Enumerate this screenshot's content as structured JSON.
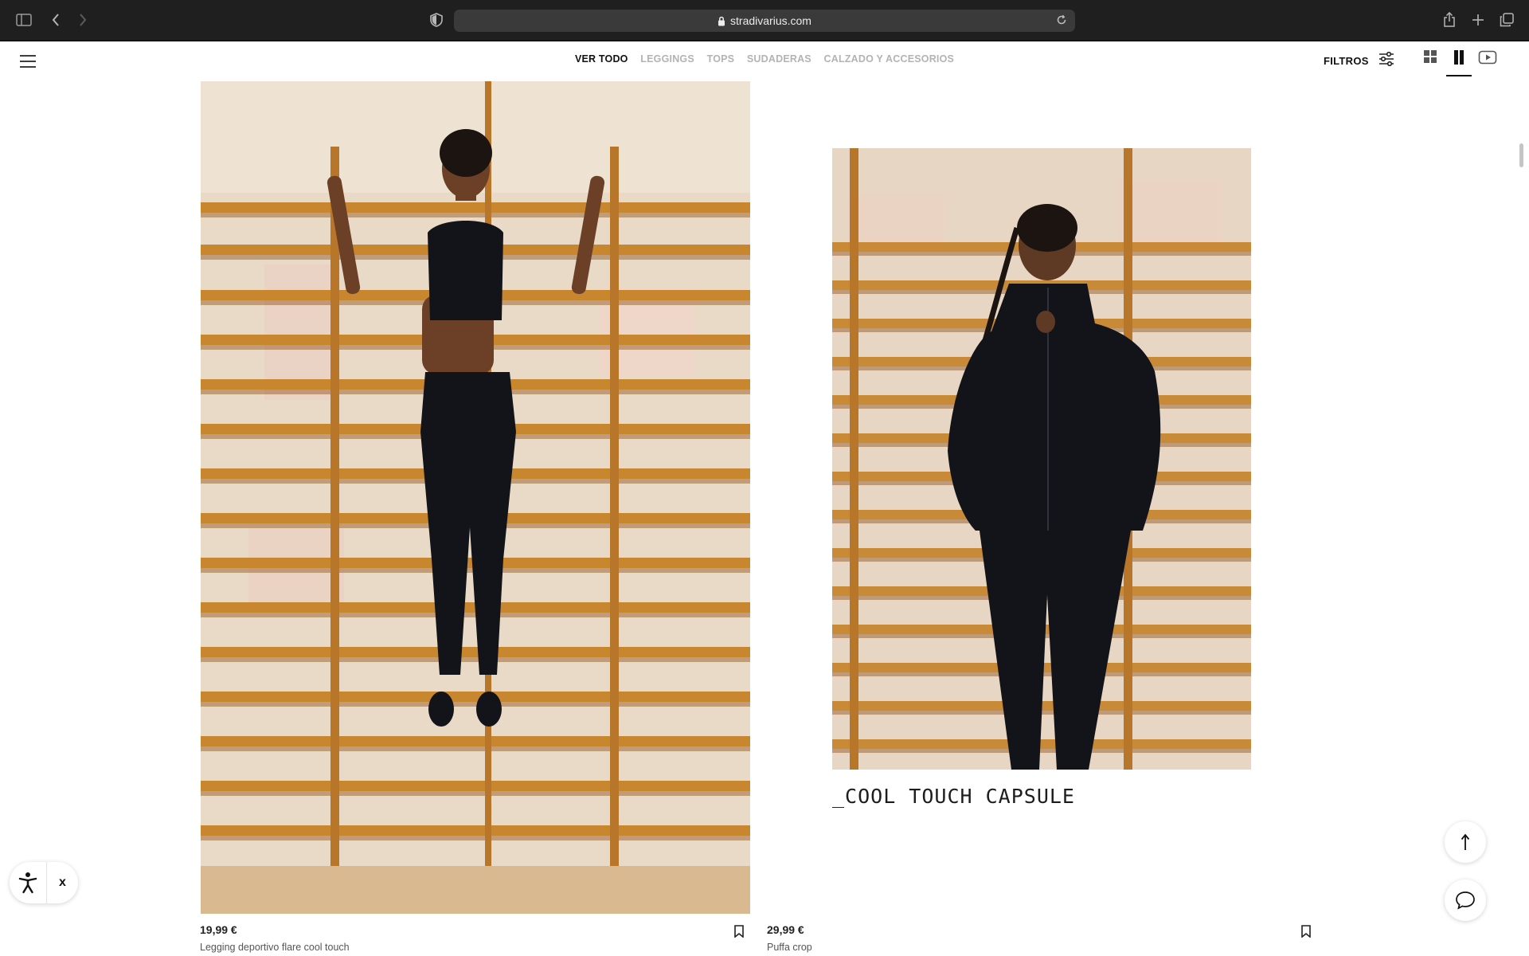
{
  "browser": {
    "url": "stradivarius.com"
  },
  "header": {
    "nav": [
      "VER TODO",
      "LEGGINGS",
      "TOPS",
      "SUDADERAS",
      "CALZADO Y ACCESORIOS"
    ],
    "filters_label": "FILTROS",
    "active_view": "two-column-view"
  },
  "products": [
    {
      "price": "19,99 €",
      "name": "Legging deportivo flare cool touch"
    },
    {
      "price": "29,99 €",
      "name": "Puffa crop"
    }
  ],
  "capsule": {
    "title": "_COOL TOUCH CAPSULE"
  },
  "accessibility": {
    "close_label": "x"
  },
  "colors": {
    "chrome": "#1f1f1f",
    "wall": "#e7d6c4",
    "wood": "#c98a38",
    "outfit": "#121419"
  }
}
